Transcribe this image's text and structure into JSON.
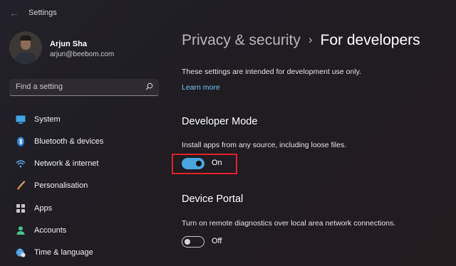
{
  "window": {
    "title": "Settings"
  },
  "profile": {
    "name": "Arjun Sha",
    "email": "arjun@beebom.com"
  },
  "search": {
    "placeholder": "Find a setting"
  },
  "nav": [
    {
      "label": "System",
      "icon": "monitor-icon"
    },
    {
      "label": "Bluetooth & devices",
      "icon": "bluetooth-icon"
    },
    {
      "label": "Network & internet",
      "icon": "wifi-icon"
    },
    {
      "label": "Personalisation",
      "icon": "brush-icon"
    },
    {
      "label": "Apps",
      "icon": "apps-icon"
    },
    {
      "label": "Accounts",
      "icon": "person-icon"
    },
    {
      "label": "Time & language",
      "icon": "globe-clock-icon"
    }
  ],
  "breadcrumb": {
    "parent": "Privacy & security",
    "separator": "›",
    "current": "For developers"
  },
  "intro": {
    "text": "These settings are intended for development use only.",
    "link": "Learn more"
  },
  "developer_mode": {
    "title": "Developer Mode",
    "description": "Install apps from any source, including loose files.",
    "state": "On",
    "enabled": true
  },
  "device_portal": {
    "title": "Device Portal",
    "description": "Turn on remote diagnostics over local area network connections.",
    "state": "Off",
    "enabled": false
  },
  "colors": {
    "accent": "#4aa6df",
    "link": "#7cc4f2",
    "highlight": "#e0222a"
  }
}
